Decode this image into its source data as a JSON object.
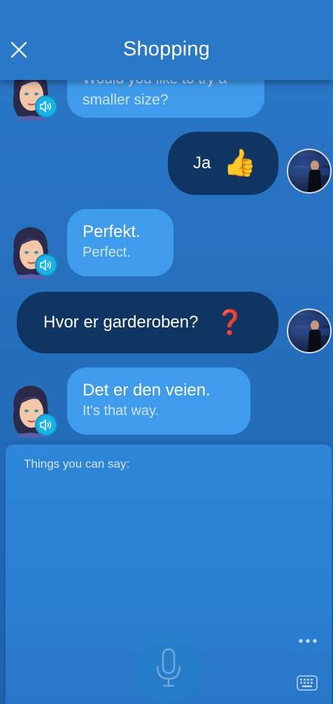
{
  "header": {
    "title": "Shopping",
    "close_icon": "close-icon"
  },
  "messages": [
    {
      "from": "tutor",
      "text": "Would you like to try a",
      "translation": "smaller size?"
    },
    {
      "from": "user",
      "text": "Ja",
      "emoji": "👍"
    },
    {
      "from": "tutor",
      "text": "Perfekt.",
      "translation": "Perfect."
    },
    {
      "from": "user",
      "text": "Hvor er garderoben?",
      "emoji": "❓"
    },
    {
      "from": "tutor",
      "text": "Det er den veien.",
      "translation": "It's that way."
    }
  ],
  "panel": {
    "label": "Things you can say:",
    "more_icon": "more-dots-icon",
    "mic_icon": "microphone-icon",
    "keyboard_icon": "keyboard-icon"
  },
  "colors": {
    "background": "#2570bd",
    "tutor_bubble": "#3f9cec",
    "user_bubble": "#0f3563",
    "speaker": "#1ab3e8"
  }
}
